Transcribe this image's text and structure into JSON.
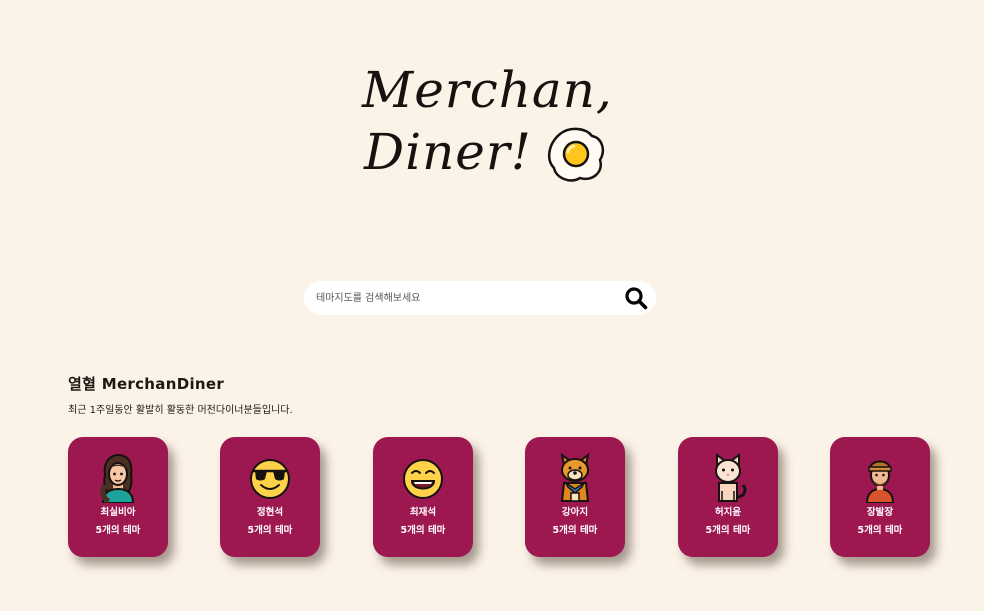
{
  "logo": {
    "line1": "Merchan,",
    "line2": "Diner!",
    "icon": "fried-egg-icon"
  },
  "search": {
    "placeholder": "테마지도를 검색해보세요",
    "icon": "search-icon"
  },
  "section": {
    "title": "열혈 MerchanDiner",
    "subtitle": "최근 1주일동안 활발히 활동한 머천다이너분들입니다."
  },
  "users": [
    {
      "name": "최실비아",
      "count": "5개의 테마",
      "avatar": "woman-avatar-icon"
    },
    {
      "name": "정현석",
      "count": "5개의 테마",
      "avatar": "sunglasses-emoji-icon"
    },
    {
      "name": "최재석",
      "count": "5개의 테마",
      "avatar": "grinning-emoji-icon"
    },
    {
      "name": "강아지",
      "count": "5개의 테마",
      "avatar": "dog-icon"
    },
    {
      "name": "허지윤",
      "count": "5개의 테마",
      "avatar": "cat-icon"
    },
    {
      "name": "장발장",
      "count": "5개의 테마",
      "avatar": "man-beanie-avatar-icon"
    }
  ],
  "colors": {
    "background": "#fcf3e8",
    "card": "#9d1750",
    "card_text": "#ffffff",
    "search_bg": "#ffffff"
  }
}
